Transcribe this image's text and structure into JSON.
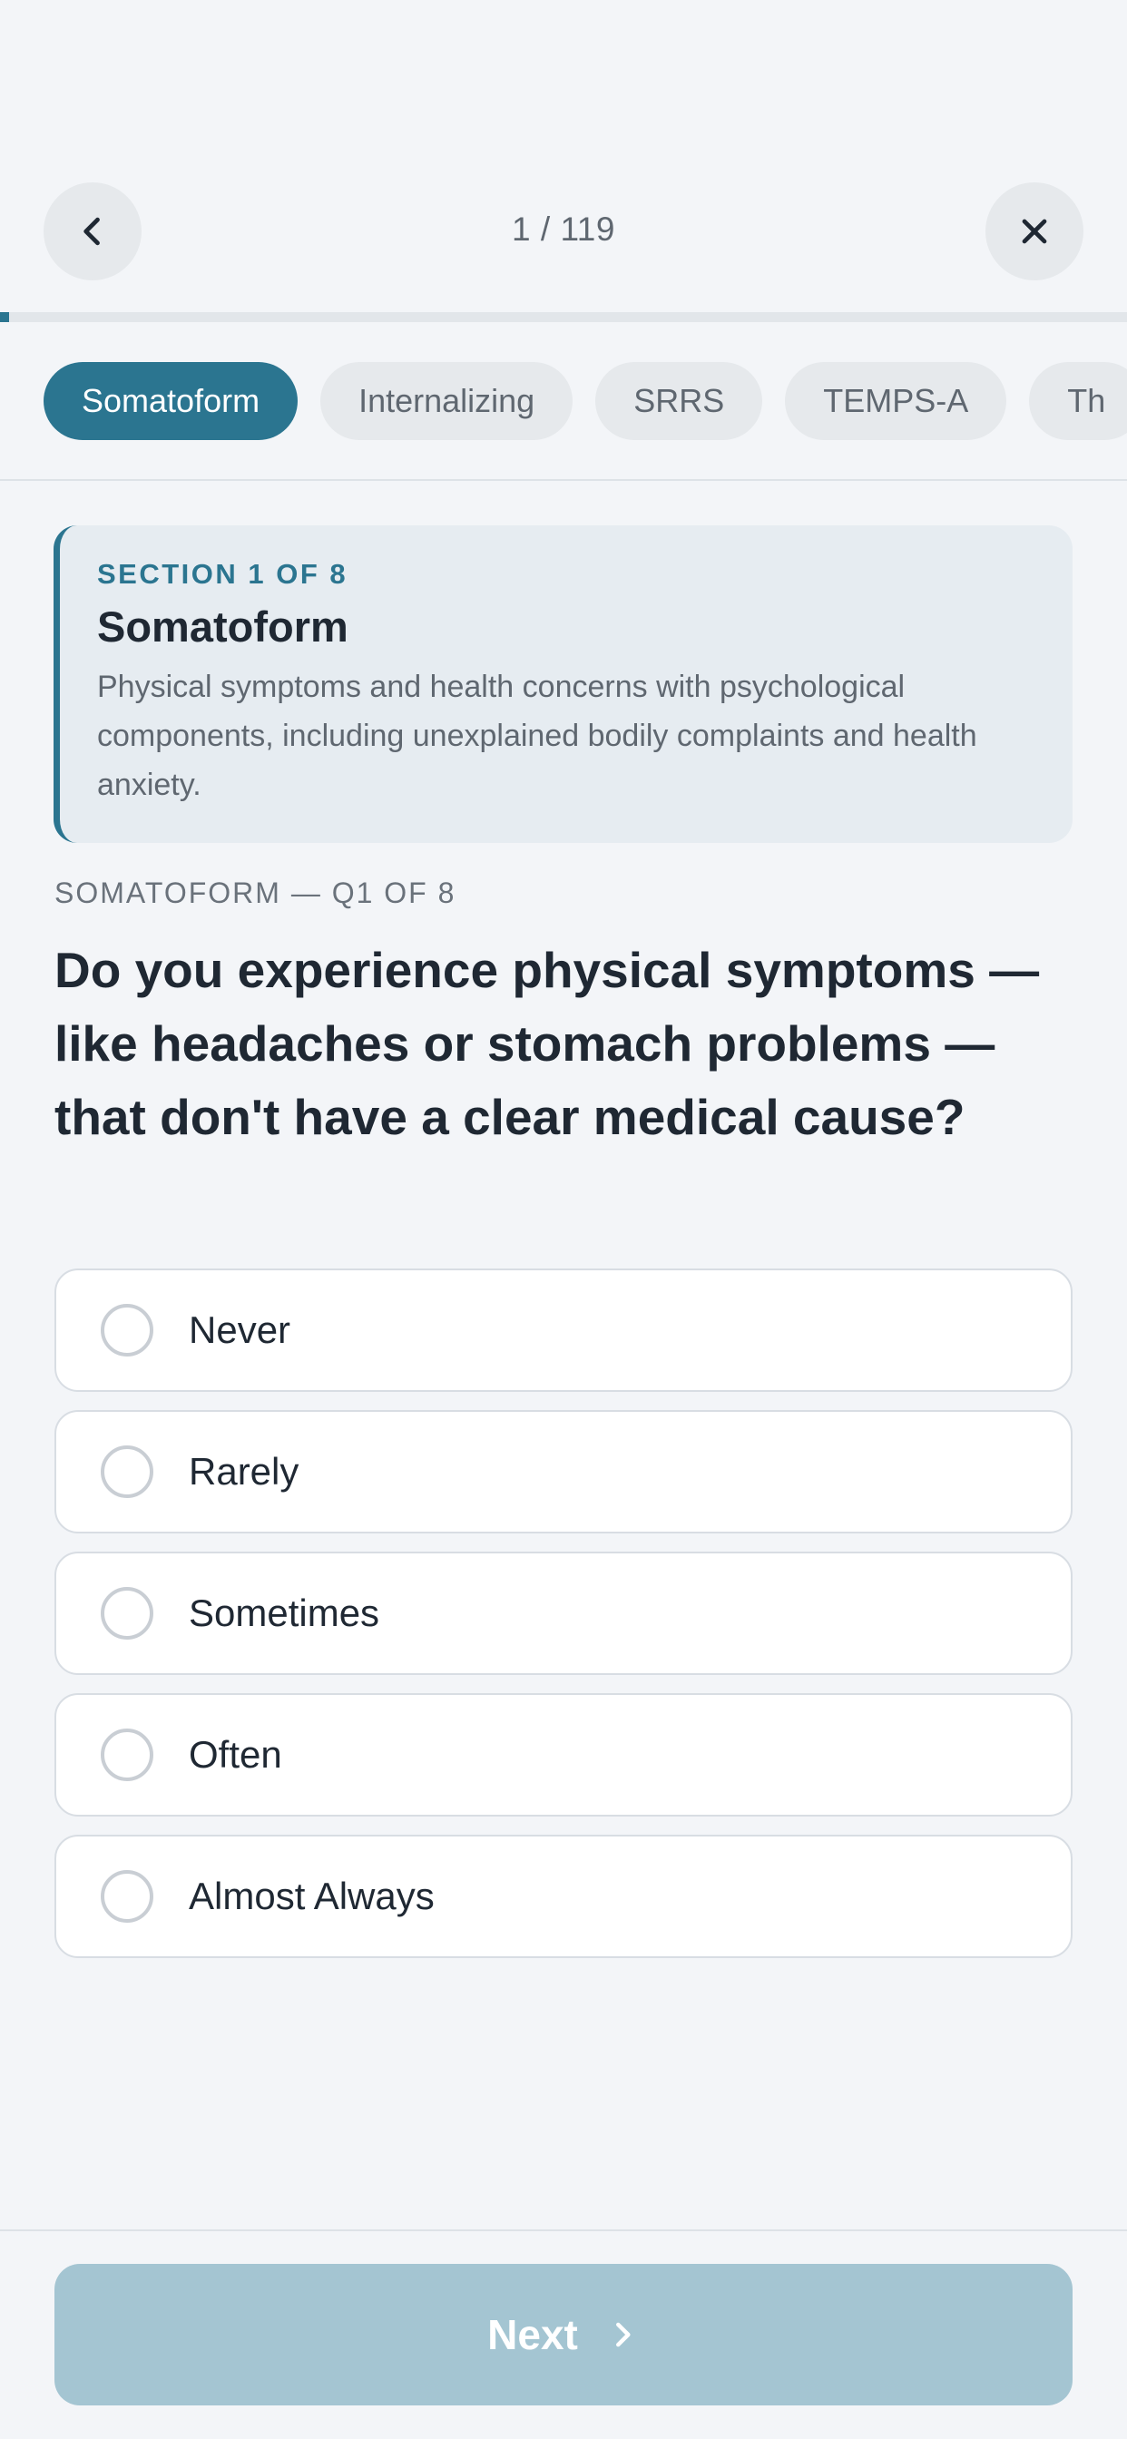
{
  "header": {
    "counter": "1 / 119",
    "back_icon": "chevron-left-icon",
    "close_icon": "close-icon",
    "progress_fraction": 0.0084
  },
  "tabs": [
    {
      "label": "Somatoform",
      "active": true
    },
    {
      "label": "Internalizing",
      "active": false
    },
    {
      "label": "SRRS",
      "active": false
    },
    {
      "label": "TEMPS-A",
      "active": false
    },
    {
      "label": "Th",
      "active": false
    }
  ],
  "section": {
    "kicker": "SECTION 1 OF 8",
    "title": "Somatoform",
    "description": "Physical symptoms and health concerns with psychological components, including unexplained bodily complaints and health anxiety."
  },
  "question": {
    "kicker": "SOMATOFORM — Q1 OF 8",
    "text": "Do you experience physical symptoms — like headaches or stomach problems — that don't have a clear medical cause?",
    "options": [
      "Never",
      "Rarely",
      "Sometimes",
      "Often",
      "Almost Always"
    ]
  },
  "footer": {
    "next_label": "Next",
    "next_icon": "chevron-right-icon"
  },
  "colors": {
    "accent": "#2b7590",
    "background": "#f3f5f8",
    "next_disabled": "#a4c5d2"
  }
}
